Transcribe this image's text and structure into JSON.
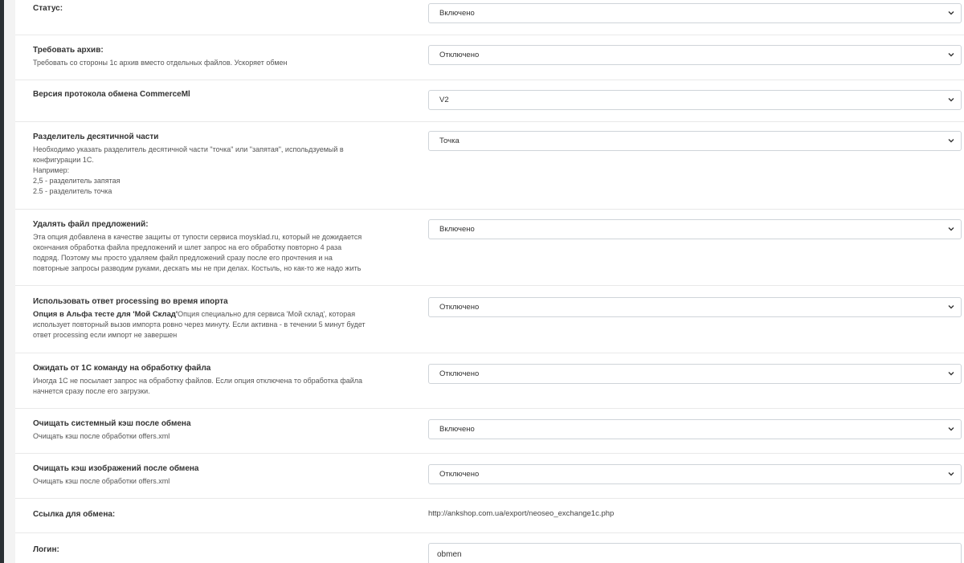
{
  "rows": [
    {
      "title": "Статус:",
      "desc": "",
      "value": "Включено"
    },
    {
      "title": "Требовать архив:",
      "desc": "Требовать со стороны 1с архив вместо отдельных файлов. Ускоряет обмен",
      "value": "Отключено"
    },
    {
      "title": "Версия протокола обмена CommerceMl",
      "desc": "",
      "value": "V2"
    },
    {
      "title": "Разделитель десятичной части",
      "desc_lines": [
        "Необходимо указать разделитель десятичной части \"точка\" или \"запятая\", испольдзуемый в",
        "конфигурации 1С.",
        "Например:",
        "2,5 - разделитель запятая",
        "2.5 - разделитель точка"
      ],
      "value": "Точка"
    },
    {
      "title": "Удалять файл предложений:",
      "desc_lines": [
        "Эта опция добавлена в качестве защиты от тупости сервиса moysklad.ru, который не дожидается",
        "окончания обработка файла предложений и шлет запрос на его обработку повторно 4 раза",
        "подряд. Поэтому мы просто удаляем файл предложений сразу после его прочтения и на",
        "повторные запросы разводим руками, дескать мы не при делах. Костыль, но как-то же надо жить"
      ],
      "value": "Включено"
    },
    {
      "title": "Использовать ответ processing во время ипорта",
      "strong": "Опция в Альфа тесте для 'Мой Склад'",
      "desc_lines": [
        "Опция специально для сервиса 'Мой склад', которая",
        "использует повторный вызов импорта ровно через минуту. Если активна - в течении 5 минут будет",
        "ответ processing если импорт не завершен"
      ],
      "value": "Отключено"
    },
    {
      "title": "Ожидать от 1С команду на обработку файла",
      "desc_lines": [
        "Иногда 1С не посылает запрос на обработку файлов. Если опция отключена то обработка файла",
        "начнется сразу после его загрузки."
      ],
      "value": "Отключено"
    },
    {
      "title": "Очищать системный кэш после обмена",
      "desc": "Очищать кэш после обработки offers.xml",
      "value": "Включено"
    },
    {
      "title": "Очищать кэш изображений после обмена",
      "desc": "Очищать кэш после обработки offers.xml",
      "value": "Отключено"
    },
    {
      "title": "Ссылка для обмена:",
      "link": "http://ankshop.com.ua/export/neoseo_exchange1c.php"
    },
    {
      "title": "Логин:",
      "input": "obmen"
    }
  ]
}
